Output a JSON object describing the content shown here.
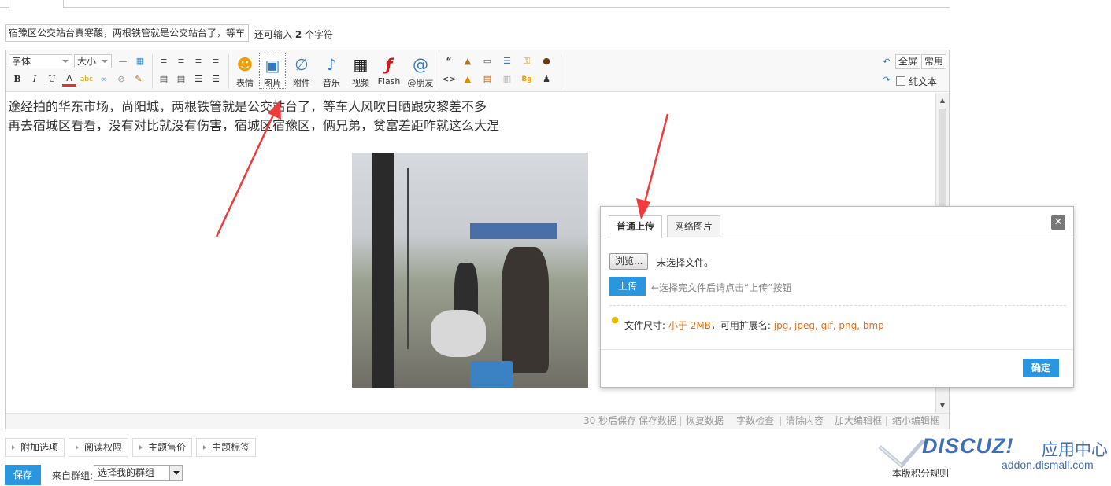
{
  "subject": {
    "value": "宿豫区公交站台真寒酸，两根铁管就是公交站台了，等车",
    "hint_prefix": "还可输入",
    "hint_count": "2",
    "hint_suffix": "个字符"
  },
  "toolbar": {
    "font_select": "字体",
    "size_select": "大小",
    "items": {
      "emoji": "表情",
      "image": "图片",
      "attach": "附件",
      "music": "音乐",
      "video": "视频",
      "flash": "Flash",
      "friends": "@朋友"
    },
    "fullscreen": "全屏",
    "common": "常用",
    "plaintext": "纯文本"
  },
  "content": {
    "line1": "途经拍的华东市场，尚阳城，两根铁管就是公交站台了，等车人风吹日晒跟灾黎差不多",
    "line2": "再去宿城区看看，没有对比就没有伤害，宿城区宿豫区，俩兄弟，贫富差距咋就这么大涅"
  },
  "statusbar": {
    "autosave": "30 秒后保存",
    "save": "保存数据",
    "restore": "恢复数据",
    "wordcount": "字数检查",
    "clear": "清除内容",
    "enlarge": "加大编辑框",
    "shrink": "缩小编辑框",
    "sep": "|"
  },
  "dialog": {
    "tab_local": "普通上传",
    "tab_web": "网络图片",
    "close": "✕",
    "browse": "浏览...",
    "no_file": "未选择文件。",
    "upload": "上传",
    "upload_hint": "←选择完文件后请点击“上传”按钮",
    "size_label": "文件尺寸:",
    "size_value": "小于 2MB",
    "ext_label": "，可用扩展名:",
    "ext_value": "jpg, jpeg, gif, png, bmp",
    "confirm": "确定"
  },
  "options": {
    "extra": "附加选项",
    "permission": "阅读权限",
    "sale": "主题售价",
    "tags": "主题标签"
  },
  "footer": {
    "save": "保存",
    "group_label": "来自群组:",
    "group_select": "选择我的群组",
    "rules": "本版积分规则"
  },
  "brand": {
    "logo": "DISCUZ!",
    "cn": "应用中心",
    "url": "addon.dismall.com"
  },
  "colors": {
    "primary_button": "#2b96e0",
    "highlight_orange": "#f26c0a",
    "annotation_arrow": "#ef3b3b",
    "brand_blue": "#3e6fb7"
  }
}
